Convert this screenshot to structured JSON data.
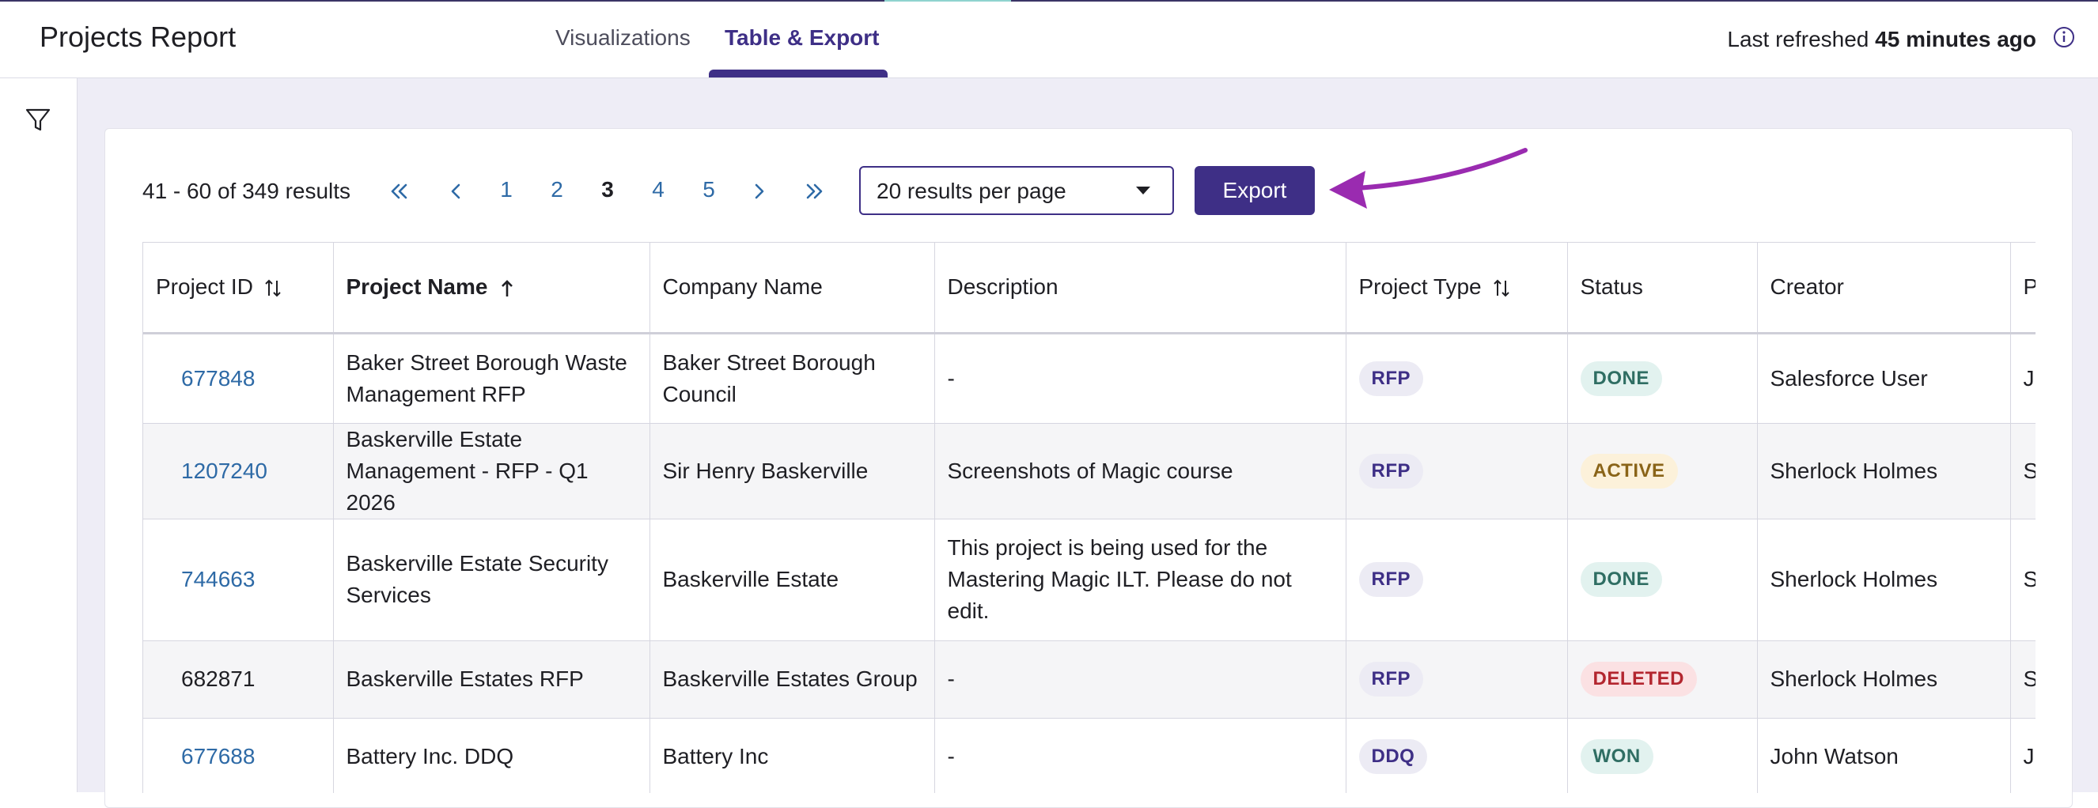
{
  "header": {
    "title": "Projects Report",
    "tabs": [
      {
        "label": "Visualizations"
      },
      {
        "label": "Table & Export"
      }
    ],
    "refresh_prefix": "Last refreshed",
    "refresh_value": "45 minutes ago"
  },
  "toolbar": {
    "results_text": "41 - 60 of 349 results",
    "pages": [
      "1",
      "2",
      "3",
      "4",
      "5"
    ],
    "current_page": "3",
    "per_page_label": "20 results per page",
    "export_label": "Export"
  },
  "table": {
    "columns": [
      "Project ID",
      "Project Name",
      "Company Name",
      "Description",
      "Project Type",
      "Status",
      "Creator",
      "P"
    ],
    "rows": [
      {
        "id": "677848",
        "name": "Baker Street Borough Waste Management RFP",
        "company": "Baker Street Borough Council",
        "description": "-",
        "type": "RFP",
        "status": "DONE",
        "creator": "Salesforce User",
        "next": "J"
      },
      {
        "id": "1207240",
        "name": "Baskerville Estate Management - RFP - Q1 2026",
        "company": "Sir Henry Baskerville",
        "description": "Screenshots of Magic course",
        "type": "RFP",
        "status": "ACTIVE",
        "creator": "Sherlock Holmes",
        "next": "S"
      },
      {
        "id": "744663",
        "name": "Baskerville Estate Security Services",
        "company": "Baskerville Estate",
        "description": "This project is being used for the Mastering Magic ILT. Please do not edit.",
        "type": "RFP",
        "status": "DONE",
        "creator": "Sherlock Holmes",
        "next": "S"
      },
      {
        "id": "682871",
        "name": "Baskerville Estates RFP",
        "company": "Baskerville Estates Group",
        "description": "-",
        "type": "RFP",
        "status": "DELETED",
        "creator": "Sherlock Holmes",
        "next": "S"
      },
      {
        "id": "677688",
        "name": "Battery Inc. DDQ",
        "company": "Battery Inc",
        "description": "-",
        "type": "DDQ",
        "status": "WON",
        "creator": "John Watson",
        "next": "J"
      }
    ]
  },
  "colors": {
    "accent": "#3e2f86",
    "link": "#2e6aa6",
    "arrow": "#9a2bb0"
  }
}
